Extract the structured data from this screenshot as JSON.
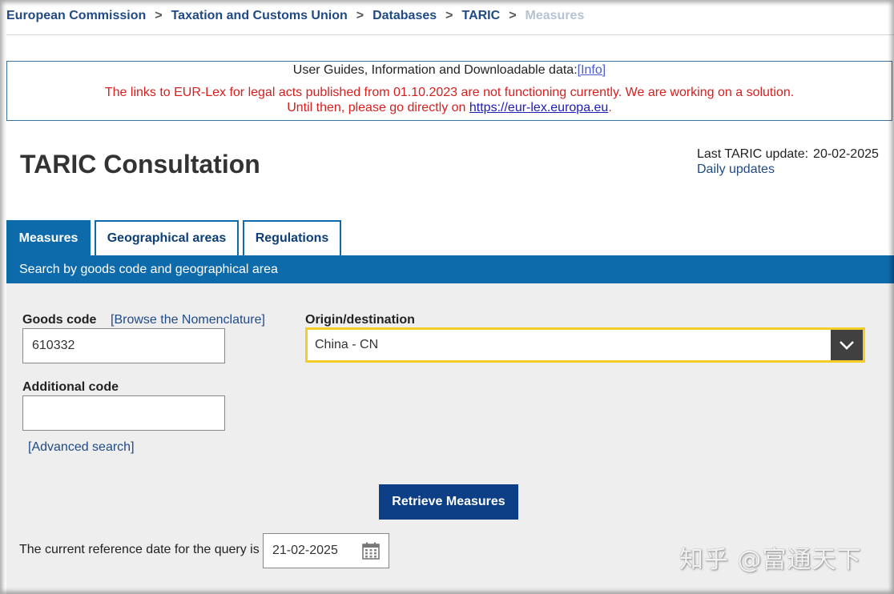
{
  "breadcrumb": {
    "items": [
      "European Commission",
      "Taxation and Customs Union",
      "Databases",
      "TARIC"
    ],
    "current": "Measures",
    "separator": ">"
  },
  "infobox": {
    "guides_text": "User Guides, Information and Downloadable data:",
    "info_link": "[Info]",
    "warning_line1": "The links to EUR-Lex for legal acts published from 01.10.2023 are not functioning currently. We are working on a solution.",
    "warning_line2_prefix": "Until then, please go directly on ",
    "warning_link": "https://eur-lex.europa.eu",
    "warning_line2_suffix": "."
  },
  "header": {
    "title": "TARIC Consultation",
    "last_update_label": "Last TARIC update:",
    "last_update_value": "20-02-2025",
    "daily_updates_link": "Daily updates"
  },
  "tabs": [
    {
      "label": "Measures",
      "active": true
    },
    {
      "label": "Geographical areas",
      "active": false
    },
    {
      "label": "Regulations",
      "active": false
    }
  ],
  "section_bar": "Search by goods code and geographical area",
  "form": {
    "goods_code_label": "Goods code",
    "browse_link": "[Browse the Nomenclature]",
    "goods_code_value": "610332",
    "origin_label": "Origin/destination",
    "origin_value": "China - CN",
    "additional_code_label": "Additional code",
    "additional_code_value": "",
    "advanced_search_link": "[Advanced search]",
    "submit_label": "Retrieve Measures",
    "ref_date_label": "The current reference date for the query is",
    "ref_date_value": "21-02-2025"
  },
  "watermark": "知乎 @富通天下",
  "colors": {
    "brand_blue": "#0d6aab",
    "button_blue": "#0c3f85",
    "link_blue": "#1f4a86",
    "warning_red": "#d62020",
    "focus_yellow": "#f3cd28"
  }
}
